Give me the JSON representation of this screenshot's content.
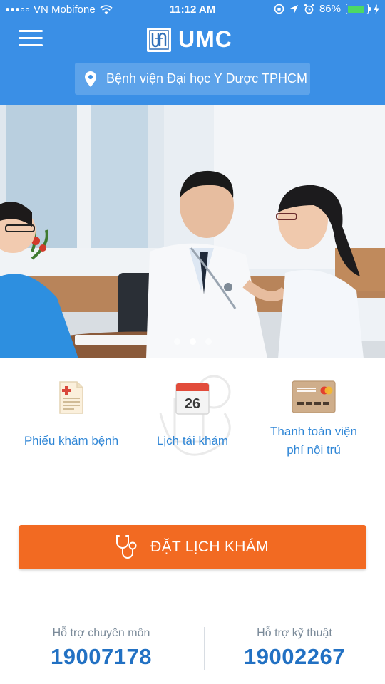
{
  "status_bar": {
    "carrier": "VN Mobifone",
    "time": "11:12 AM",
    "battery": "86%",
    "battery_level": 0.86
  },
  "header": {
    "brand": "UMC",
    "hospital": "Bệnh viện Đại học Y Dược TPHCM",
    "background_color": "#3a8fe6"
  },
  "banner": {
    "slide_count": 3,
    "active_slide": 1
  },
  "actions": [
    {
      "label": "Phiếu khám bệnh",
      "icon": "medical-form-icon"
    },
    {
      "label": "Lịch tái khám",
      "icon": "calendar-icon",
      "icon_text": "26"
    },
    {
      "label_line1": "Thanh toán viện",
      "label_line2": "phí nội trú",
      "icon": "payment-card-icon"
    }
  ],
  "booking": {
    "label": "ĐẶT LỊCH KHÁM",
    "icon": "stethoscope-icon",
    "color": "#f26a22"
  },
  "support": {
    "professional": {
      "label": "Hỗ trợ chuyên môn",
      "number": "19007178"
    },
    "technical": {
      "label": "Hỗ trợ kỹ thuật",
      "number": "19002267"
    }
  }
}
